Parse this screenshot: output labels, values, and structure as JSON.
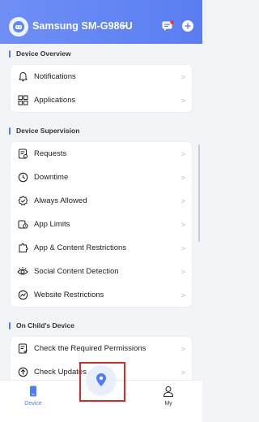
{
  "header": {
    "device_name": "Samsung SM-G986U"
  },
  "sections": {
    "overview": {
      "title": "Device Overview",
      "items": [
        {
          "label": "Notifications",
          "icon": "bell-icon"
        },
        {
          "label": "Applications",
          "icon": "grid-icon"
        }
      ]
    },
    "supervision": {
      "title": "Device Supervision",
      "items": [
        {
          "label": "Requests",
          "icon": "requests-icon"
        },
        {
          "label": "Downtime",
          "icon": "clock-icon"
        },
        {
          "label": "Always Allowed",
          "icon": "check-badge-icon"
        },
        {
          "label": "App Limits",
          "icon": "app-limits-icon"
        },
        {
          "label": "App & Content Restrictions",
          "icon": "puzzle-icon"
        },
        {
          "label": "Social Content Detection",
          "icon": "eye-icon"
        },
        {
          "label": "Website Restrictions",
          "icon": "globe-icon"
        }
      ]
    },
    "on_child": {
      "title": "On Child's Device",
      "items": [
        {
          "label": "Check the Required Permissions",
          "icon": "permissions-icon"
        },
        {
          "label": "Check Updates",
          "icon": "upload-icon"
        }
      ]
    }
  },
  "tabbar": {
    "device_label": "Device",
    "my_label": "My"
  },
  "colors": {
    "header": "#5a7ef2",
    "accent": "#4f7cf7",
    "highlight": "#d62a2a",
    "notification_dot": "#e53935"
  }
}
